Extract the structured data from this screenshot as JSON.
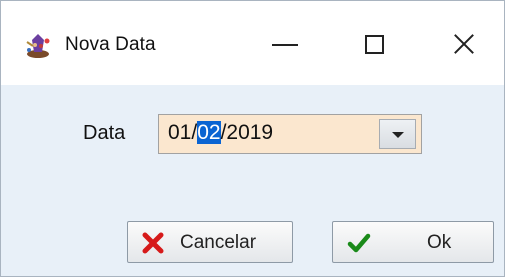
{
  "window": {
    "title": "Nova Data",
    "app_icon": "wizard-app-icon",
    "controls": {
      "minimize_icon": "minimize-icon",
      "maximize_icon": "maximize-icon",
      "close_icon": "close-icon"
    }
  },
  "form": {
    "date_label": "Data",
    "date_value": {
      "before": "01/",
      "selected": "02",
      "after": "/2019"
    },
    "dropdown_icon": "chevron-down-icon"
  },
  "buttons": {
    "cancel_label": "Cancelar",
    "cancel_icon": "red-x-icon",
    "ok_label": "Ok",
    "ok_icon": "green-check-icon"
  },
  "colors": {
    "date_field_bg": "#fbe7cf",
    "selection": "#0a64d2",
    "cancel_icon": "#d61a1a",
    "ok_icon": "#1a8a1a"
  }
}
